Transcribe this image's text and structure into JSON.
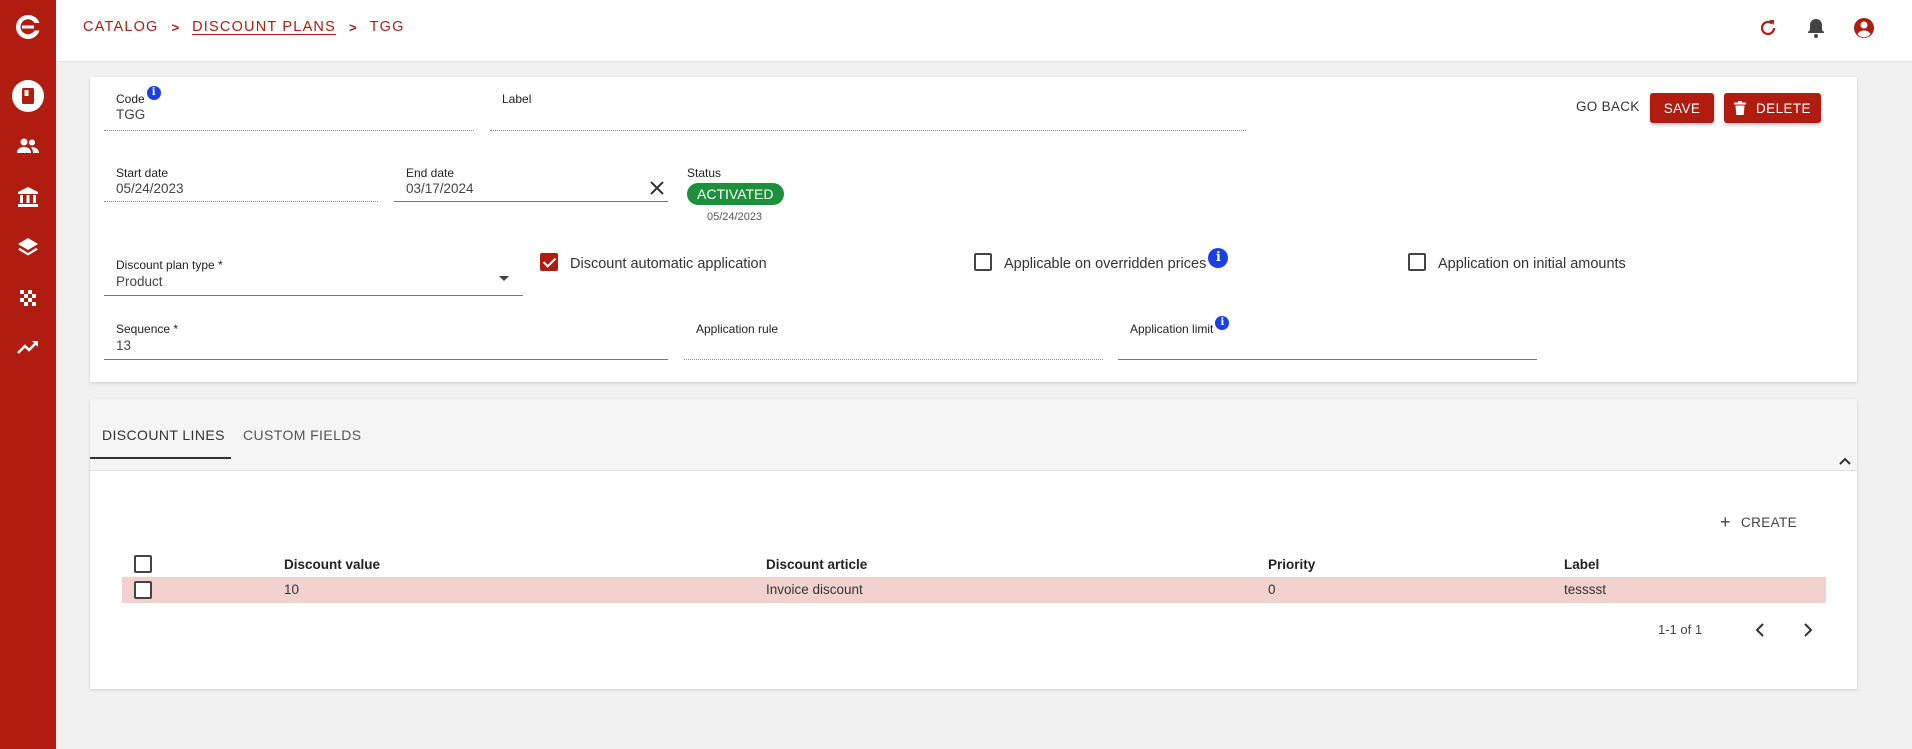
{
  "breadcrumb": {
    "catalog": "CATALOG",
    "discount_plans": "DISCOUNT PLANS",
    "current": "TGG",
    "sep": ">"
  },
  "form": {
    "code": {
      "label": "Code",
      "value": "TGG",
      "info": "i"
    },
    "label": {
      "label": "Label",
      "value": ""
    },
    "start_date": {
      "label": "Start date",
      "value": "05/24/2023"
    },
    "end_date": {
      "label": "End date",
      "value": "03/17/2024"
    },
    "status": {
      "label": "Status",
      "badge": "ACTIVATED",
      "date": "05/24/2023"
    },
    "discount_plan_type": {
      "label": "Discount plan type *",
      "value": "Product"
    },
    "discount_automatic_application": {
      "label": "Discount automatic application",
      "checked": true
    },
    "applicable_on_overridden_prices": {
      "label": "Applicable on overridden prices",
      "checked": false,
      "info": "i"
    },
    "application_on_initial_amounts": {
      "label": "Application on initial amounts",
      "checked": false
    },
    "sequence": {
      "label": "Sequence *",
      "value": "13"
    },
    "application_rule": {
      "label": "Application rule",
      "value": ""
    },
    "application_limit": {
      "label": "Application limit",
      "value": "",
      "info": "i"
    }
  },
  "actions": {
    "go_back": "GO BACK",
    "save": "SAVE",
    "delete": "DELETE"
  },
  "tabs": [
    {
      "label": "DISCOUNT LINES",
      "active": true
    },
    {
      "label": "CUSTOM FIELDS",
      "active": false
    }
  ],
  "table": {
    "create_label": "CREATE",
    "columns": [
      "Discount value",
      "Discount article",
      "Priority",
      "Label"
    ],
    "rows": [
      {
        "discount_value": "10",
        "discount_article": "Invoice discount",
        "priority": "0",
        "label": "tesssst",
        "selected": false
      }
    ],
    "pagination": "1-1 of 1"
  },
  "colors": {
    "brand": "#b01c0f",
    "status_active": "#1e8f3a",
    "info": "#1a3ee8",
    "row_highlight": "#f2d2cf"
  },
  "icons": {
    "sidebar": [
      "app-logo-icon",
      "book-icon",
      "users-icon",
      "bank-icon",
      "layers-icon",
      "grid-dots-icon",
      "trending-up-icon"
    ],
    "header": [
      "refresh-icon",
      "bell-icon",
      "account-circle-icon"
    ]
  }
}
